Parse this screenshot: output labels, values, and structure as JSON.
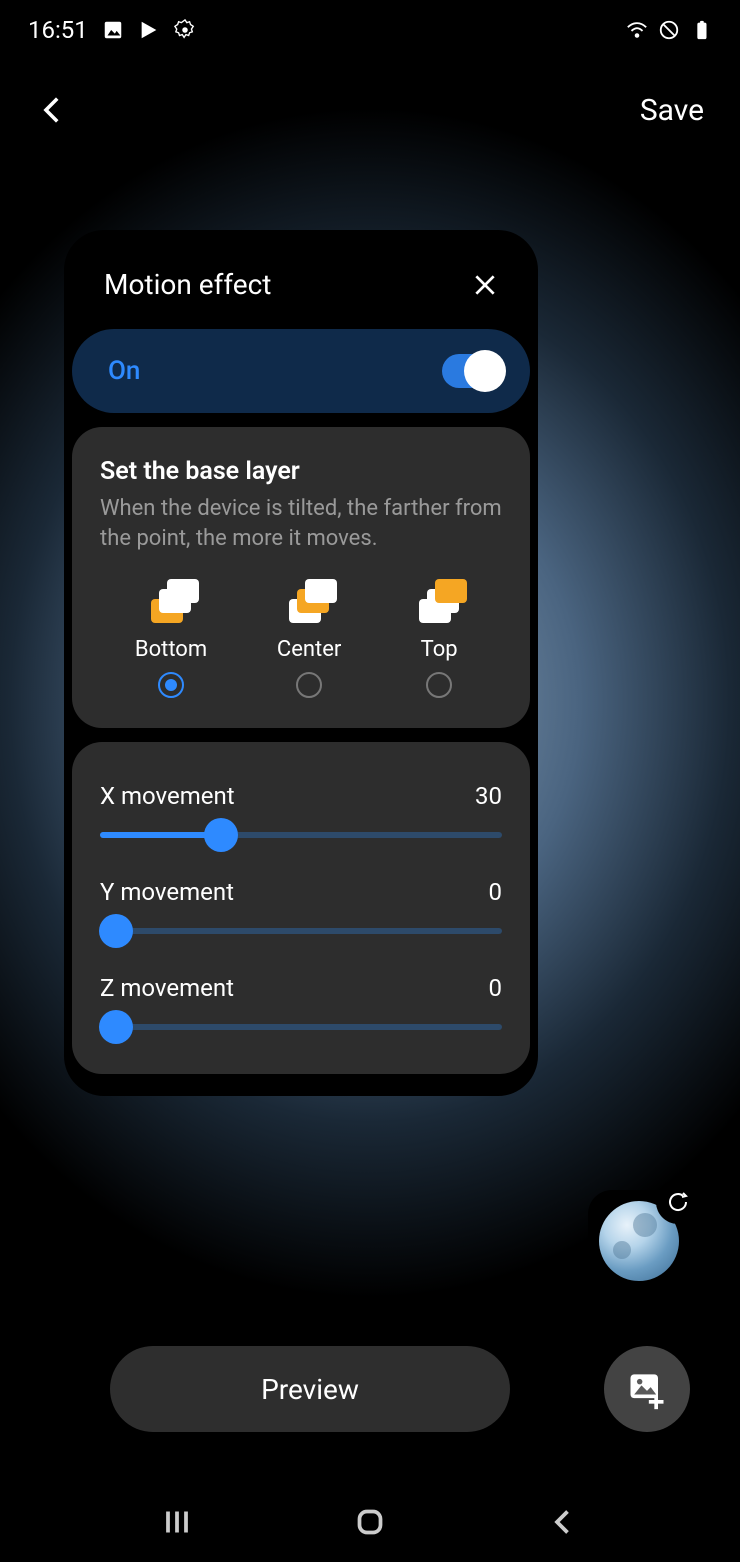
{
  "status": {
    "time": "16:51"
  },
  "header": {
    "save": "Save"
  },
  "card": {
    "title": "Motion effect",
    "toggle_label": "On",
    "base_title": "Set the base layer",
    "base_desc": "When the device is tilted, the farther from the point, the more it moves.",
    "options": [
      "Bottom",
      "Center",
      "Top"
    ],
    "selected_option": 0,
    "sliders": [
      {
        "label": "X movement",
        "value": "30",
        "percent": 30
      },
      {
        "label": "Y movement",
        "value": "0",
        "percent": 0
      },
      {
        "label": "Z movement",
        "value": "0",
        "percent": 0
      }
    ]
  },
  "preview": "Preview"
}
